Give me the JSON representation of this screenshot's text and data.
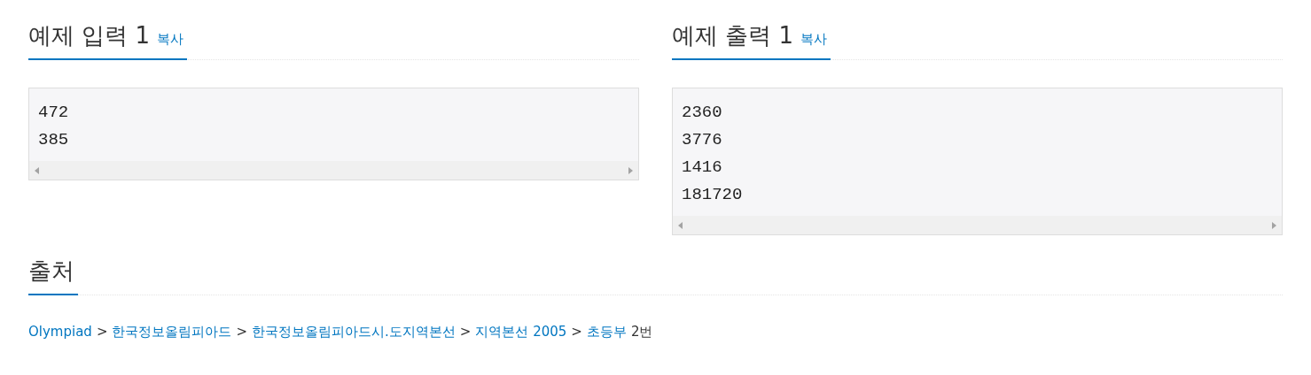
{
  "samples": [
    {
      "title": "예제 입력 1",
      "copy": "복사",
      "lines": [
        "472",
        "385"
      ]
    },
    {
      "title": "예제 출력 1",
      "copy": "복사",
      "lines": [
        "2360",
        "3776",
        "1416",
        "181720"
      ]
    }
  ],
  "source": {
    "title": "출처",
    "links": [
      "Olympiad",
      "한국정보올림피아드",
      "한국정보올림피아드시.도지역본선",
      "지역본선 2005",
      "초등부"
    ],
    "separator": ">",
    "suffix": "2번"
  }
}
